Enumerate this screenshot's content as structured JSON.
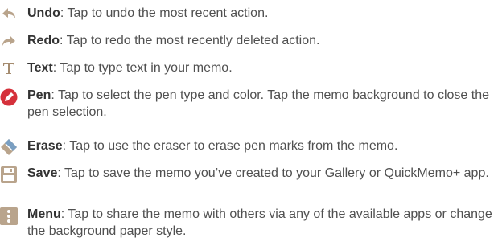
{
  "items": [
    {
      "icon": "undo-icon",
      "term": "Undo",
      "desc": ": Tap to undo the most recent action."
    },
    {
      "icon": "redo-icon",
      "term": "Redo",
      "desc": ": Tap to redo the most recently deleted action."
    },
    {
      "icon": "text-icon",
      "term": "Text",
      "desc": ": Tap to type text in your memo."
    },
    {
      "icon": "pen-icon",
      "term": "Pen",
      "desc": ": Tap to select the pen type and color. Tap the memo background to close the pen selection."
    },
    {
      "icon": "eraser-icon",
      "term": "Erase",
      "desc": ": Tap to use the eraser to erase pen marks from the memo."
    },
    {
      "icon": "save-icon",
      "term": "Save",
      "desc": ": Tap to save the memo you’ve created to your Gallery or QuickMemo+ app."
    },
    {
      "icon": "menu-icon",
      "term": "Menu",
      "desc": ": Tap to share the memo with others via any of the available apps or change the background paper style."
    }
  ],
  "colors": {
    "icon_bg": "#b9a48c",
    "icon_fg": "#ffffff",
    "pen_red": "#d5313b",
    "text": "#505050"
  }
}
